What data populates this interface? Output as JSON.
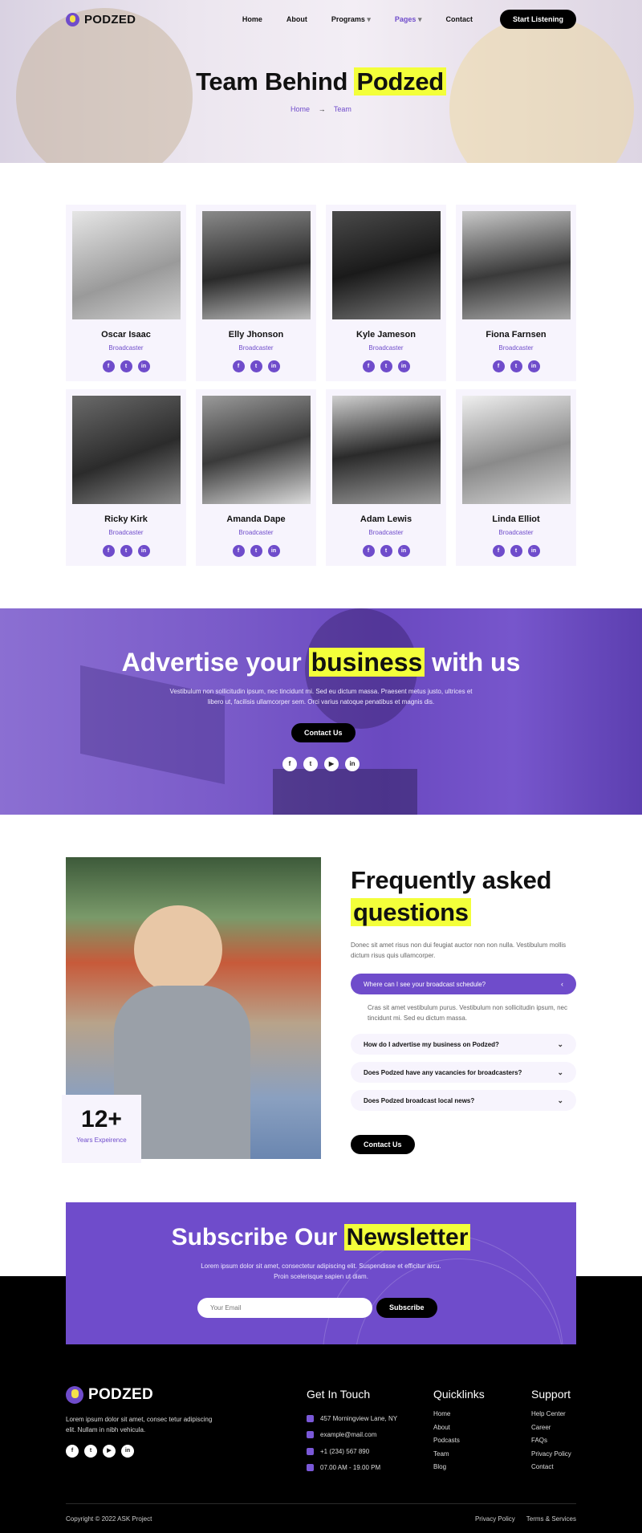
{
  "brand": {
    "name": "PODZED",
    "accent": "#6f4ccb",
    "highlight": "#f3ff3a"
  },
  "nav": {
    "items": [
      "Home",
      "About",
      "Programs",
      "Pages",
      "Contact"
    ],
    "cta": "Start Listening"
  },
  "hero": {
    "title_pre": "Team Behind",
    "title_hl": "Podzed",
    "crumb_home": "Home",
    "crumb_current": "Team"
  },
  "team": [
    {
      "name": "Oscar Isaac",
      "role": "Broadcaster"
    },
    {
      "name": "Elly Jhonson",
      "role": "Broadcaster"
    },
    {
      "name": "Kyle Jameson",
      "role": "Broadcaster"
    },
    {
      "name": "Fiona Farnsen",
      "role": "Broadcaster"
    },
    {
      "name": "Ricky Kirk",
      "role": "Broadcaster"
    },
    {
      "name": "Amanda Dape",
      "role": "Broadcaster"
    },
    {
      "name": "Adam Lewis",
      "role": "Broadcaster"
    },
    {
      "name": "Linda Elliot",
      "role": "Broadcaster"
    }
  ],
  "advertise": {
    "title_pre": "Advertise your",
    "title_hl": "business",
    "title_post": "with us",
    "text": "Vestibulum non sollicitudin ipsum, nec tincidunt mi. Sed eu dictum massa. Praesent metus justo, ultrices et libero ut, facilisis ullamcorper sem. Orci varius natoque penatibus et magnis dis.",
    "button": "Contact Us"
  },
  "faq": {
    "title_line1": "Frequently asked",
    "title_hl": "questions",
    "lead": "Donec sit amet risus non dui feugiat auctor non non nulla. Vestibulum mollis dictum risus quis ullamcorper.",
    "items": [
      "Where can I see your broadcast schedule?",
      "How do I advertise my business on Podzed?",
      "Does Podzed have any vacancies for broadcasters?",
      "Does Podzed broadcast local news?"
    ],
    "answer": "Cras sit amet vestibulum purus. Vestibulum non sollicitudin ipsum, nec tincidunt mi. Sed eu dictum massa.",
    "button": "Contact Us",
    "experience_number": "12+",
    "experience_label": "Years Expeirence"
  },
  "newsletter": {
    "title_pre": "Subscribe Our",
    "title_hl": "Newsletter",
    "text": "Lorem ipsum dolor sit amet, consectetur adipiscing elit. Suspendisse et efficitur arcu. Proin scelerisque sapien ut diam.",
    "placeholder": "Your Email",
    "button": "Subscribe"
  },
  "footer": {
    "about": "Lorem ipsum dolor sit amet, consec tetur adipiscing elit. Nullam in nibh vehicula.",
    "contact_title": "Get In Touch",
    "contact": [
      "457 Morningview Lane, NY",
      "example@mail.com",
      "+1 (234) 567 890",
      "07.00 AM - 19.00 PM"
    ],
    "quick_title": "Quicklinks",
    "quick": [
      "Home",
      "About",
      "Podcasts",
      "Team",
      "Blog"
    ],
    "support_title": "Support",
    "support": [
      "Help Center",
      "Career",
      "FAQs",
      "Privacy Policy",
      "Contact"
    ],
    "copyright": "Copyright © 2022 ASK Project",
    "legal": [
      "Privacy Policy",
      "Terms & Services"
    ]
  }
}
